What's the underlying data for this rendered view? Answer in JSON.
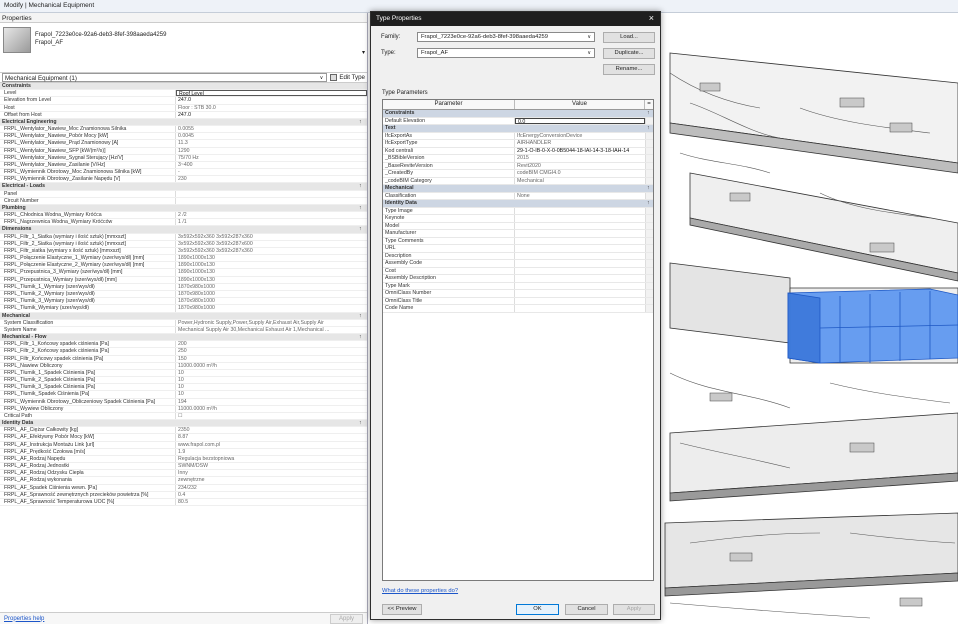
{
  "window": {
    "title": "Modify | Mechanical Equipment"
  },
  "properties": {
    "header": "Properties",
    "family_line1": "Frapol_7223e0ce-92a6-deb3-8fef-398aaeda4259",
    "family_line2": "Frapol_AF",
    "category_filter": "Mechanical Equipment (1)",
    "edit_type_label": "Edit Type",
    "help_link": "Properties help",
    "apply_label": "Apply",
    "rows": [
      {
        "t": "g",
        "k": "Constraints",
        "v": ""
      },
      {
        "t": "r",
        "k": "Level",
        "v": "Roof Level",
        "e": true
      },
      {
        "t": "r",
        "k": "Elevation from Level",
        "v": "247.0",
        "e": true,
        "nb": true
      },
      {
        "t": "r",
        "k": "Host",
        "v": "Floor : STB 30.0"
      },
      {
        "t": "r",
        "k": "Offset from Host",
        "v": "247.0",
        "e": true,
        "nb": true
      },
      {
        "t": "g",
        "k": "Electrical Engineering",
        "v": "↑"
      },
      {
        "t": "r",
        "k": "FRPL_Wentylator_Nawiew_Moc Znamionowa Silnika",
        "v": "0.0055"
      },
      {
        "t": "r",
        "k": "FRPL_Wentylator_Nawiew_Pobór Mocy [kW]",
        "v": "0.0045"
      },
      {
        "t": "r",
        "k": "FRPL_Wentylator_Nawiew_Prąd Znamionowy [A]",
        "v": "11.3"
      },
      {
        "t": "r",
        "k": "FRPL_Wentylator_Nawiew_SFP [kW/(m³/s)]",
        "v": "1290"
      },
      {
        "t": "r",
        "k": "FRPL_Wentylator_Nawiew_Sygnał Sterujący [Hz/V]",
        "v": "75/70 Hz"
      },
      {
        "t": "r",
        "k": "FRPL_Wentylator_Nawiew_Zasilanie [V/Hz]",
        "v": "3~400"
      },
      {
        "t": "r",
        "k": "FRPL_Wymiennik Obrotowy_Moc Znamionowa Silnika [kW]",
        "v": "-"
      },
      {
        "t": "r",
        "k": "FRPL_Wymiennik Obrotowy_Zasilanie Napędu [V]",
        "v": "230"
      },
      {
        "t": "g",
        "k": "Electrical - Loads",
        "v": "↑"
      },
      {
        "t": "r",
        "k": "Panel",
        "v": ""
      },
      {
        "t": "r",
        "k": "Circuit Number",
        "v": ""
      },
      {
        "t": "g",
        "k": "Plumbing",
        "v": "↑"
      },
      {
        "t": "r",
        "k": "FRPL_Chłodnica Wodna_Wymiary Króćca",
        "v": "2 /2"
      },
      {
        "t": "r",
        "k": "FRPL_Nagrzewnica Wodna_Wymiary Króćców",
        "v": "1 /1"
      },
      {
        "t": "g",
        "k": "Dimensions",
        "v": "↑"
      },
      {
        "t": "r",
        "k": "FRPL_Filtr_1_Siatka (wymiary i ilość sztuk) [mmxszt]",
        "v": "3x592x592x360 3x592x287x360"
      },
      {
        "t": "r",
        "k": "FRPL_Filtr_2_Siatka (wymiary i ilość sztuk) [mmxszt]",
        "v": "3x592x592x360 3x592x287x600"
      },
      {
        "t": "r",
        "k": "FRPL_Filtr_siatka (wymiary x ilość sztuk) [mmxszt]",
        "v": "3x592x592x360 3x592x287x360"
      },
      {
        "t": "r",
        "k": "FRPL_Połączenie Elastyczne_1_Wymiary (szer/wys/dł) [mm]",
        "v": "1890x1000x130"
      },
      {
        "t": "r",
        "k": "FRPL_Połączenie Elastyczne_2_Wymiary (szer/wys/dł) [mm]",
        "v": "1890x1000x130"
      },
      {
        "t": "r",
        "k": "FRPL_Przepustnica_3_Wymiary (szer/wys/dł) [mm]",
        "v": "1890x1000x130"
      },
      {
        "t": "r",
        "k": "FRPL_Przepustnica_Wymiary (szer/wys/dł) [mm]",
        "v": "1890x1000x130"
      },
      {
        "t": "r",
        "k": "FRPL_Tłumik_1_Wymiary (szer/wys/dł)",
        "v": "1870x980x1000"
      },
      {
        "t": "r",
        "k": "FRPL_Tłumik_2_Wymiary (szer/wys/dł)",
        "v": "1870x980x1000"
      },
      {
        "t": "r",
        "k": "FRPL_Tłumik_3_Wymiary (szer/wys/dł)",
        "v": "1870x980x1000"
      },
      {
        "t": "r",
        "k": "FRPL_Tłumik_Wymiary (szer/wys/dł)",
        "v": "1870x980x1000"
      },
      {
        "t": "g",
        "k": "Mechanical",
        "v": "↑"
      },
      {
        "t": "r",
        "k": "System Classification",
        "v": "Power,Hydronic Supply,Power,Supply Air,Exhaust Air,Supply Air"
      },
      {
        "t": "r",
        "k": "System Name",
        "v": "Mechanical Supply Air 30,Mechanical Exhaust Air 1,Mechanical ..."
      },
      {
        "t": "g",
        "k": "Mechanical - Flow",
        "v": "↑"
      },
      {
        "t": "r",
        "k": "FRPL_Filtr_1_Końcowy spadek ciśnienia [Pa]",
        "v": "200"
      },
      {
        "t": "r",
        "k": "FRPL_Filtr_2_Końcowy spadek ciśnienia [Pa]",
        "v": "250"
      },
      {
        "t": "r",
        "k": "FRPL_Filtr_Końcowy spadek ciśnienia [Pa]",
        "v": "150"
      },
      {
        "t": "r",
        "k": "FRPL_Nawiew Obliczony",
        "v": "11000.0000 m³/h"
      },
      {
        "t": "r",
        "k": "FRPL_Tłumik_1_Spadek Ciśnienia [Pa]",
        "v": "10"
      },
      {
        "t": "r",
        "k": "FRPL_Tłumik_2_Spadek Ciśnienia [Pa]",
        "v": "10"
      },
      {
        "t": "r",
        "k": "FRPL_Tłumik_3_Spadek Ciśnienia [Pa]",
        "v": "10"
      },
      {
        "t": "r",
        "k": "FRPL_Tłumik_Spadek Ciśnienia [Pa]",
        "v": "10"
      },
      {
        "t": "r",
        "k": "FRPL_Wymiennik Obrotowy_Obliczeniowy Spadek Ciśnienia [Pa]",
        "v": "194"
      },
      {
        "t": "r",
        "k": "FRPL_Wywiew Obliczony",
        "v": "11000.0000 m³/h"
      },
      {
        "t": "r",
        "k": "Critical Path",
        "v": "☐"
      },
      {
        "t": "g",
        "k": "Identity Data",
        "v": "↑"
      },
      {
        "t": "r",
        "k": "FRPL_AF_Ciężar Całkowity [kg]",
        "v": "2350"
      },
      {
        "t": "r",
        "k": "FRPL_AF_Efektywny Pobór Mocy [kW]",
        "v": "8.87"
      },
      {
        "t": "r",
        "k": "FRPL_AF_Instrukcja Montażu Link [url]",
        "v": "www.frapol.com.pl"
      },
      {
        "t": "r",
        "k": "FRPL_AF_Prędkość Czołowa [m/s]",
        "v": "1.9"
      },
      {
        "t": "r",
        "k": "FRPL_AF_Rodzaj Napędu",
        "v": "Regulacja bezstopniowa"
      },
      {
        "t": "r",
        "k": "FRPL_AF_Rodzaj Jednostki",
        "v": "SWNM/DSW"
      },
      {
        "t": "r",
        "k": "FRPL_AF_Rodzaj Odzysku Ciepła",
        "v": "Inny"
      },
      {
        "t": "r",
        "k": "FRPL_AF_Rodzaj wykonania",
        "v": "zewnętrzne"
      },
      {
        "t": "r",
        "k": "FRPL_AF_Spadek Ciśnienia wewn. [Pa]",
        "v": "234/232"
      },
      {
        "t": "r",
        "k": "FRPL_AF_Sprawność zewnętrznych przecieków powietrza [%]",
        "v": "0.4"
      },
      {
        "t": "r",
        "k": "FRPL_AF_Sprawność Temperaturowa UOC [%]",
        "v": "80.5"
      }
    ]
  },
  "dialog": {
    "title": "Type Properties",
    "family_label": "Family:",
    "family_value": "Frapol_7223e0ce-92a6-deb3-8fef-398aaeda4259",
    "type_label": "Type:",
    "type_value": "Frapol_AF",
    "load_btn": "Load...",
    "duplicate_btn": "Duplicate...",
    "rename_btn": "Rename...",
    "type_params_label": "Type Parameters",
    "col_param": "Parameter",
    "col_value": "Value",
    "col_marker": "=",
    "rows": [
      {
        "t": "g",
        "k": "Constraints",
        "v": "↑"
      },
      {
        "t": "r",
        "k": "Default Elevation",
        "v": "0.0",
        "e": true
      },
      {
        "t": "g",
        "k": "Text",
        "v": "↑"
      },
      {
        "t": "r",
        "k": "IfcExportAs",
        "v": "IfcEnergyConversionDevice"
      },
      {
        "t": "r",
        "k": "IfcExportType",
        "v": "AIRHANDLER"
      },
      {
        "t": "r",
        "k": "Kod centrali",
        "v": "29-1-O-IB-0-X-0-0B5044-18-IAI-14-3-18-IAH-14",
        "dark": true
      },
      {
        "t": "r",
        "k": "_BSBibleVersion",
        "v": "2015"
      },
      {
        "t": "r",
        "k": "_BaseReviteVersion",
        "v": "Revit2020"
      },
      {
        "t": "r",
        "k": "_CreatedBy",
        "v": "codeBIM  CMGI4.0"
      },
      {
        "t": "r",
        "k": "_codeBIM Category",
        "v": "Mechanical"
      },
      {
        "t": "g",
        "k": "Mechanical",
        "v": "↑"
      },
      {
        "t": "r",
        "k": "Classification",
        "v": "None"
      },
      {
        "t": "g",
        "k": "Identity Data",
        "v": "↑"
      },
      {
        "t": "r",
        "k": "Type Image",
        "v": ""
      },
      {
        "t": "r",
        "k": "Keynote",
        "v": "",
        "dark": true
      },
      {
        "t": "r",
        "k": "Model",
        "v": "",
        "dark": true
      },
      {
        "t": "r",
        "k": "Manufacturer",
        "v": "",
        "dark": true
      },
      {
        "t": "r",
        "k": "Type Comments",
        "v": "",
        "dark": true
      },
      {
        "t": "r",
        "k": "URL",
        "v": "",
        "dark": true
      },
      {
        "t": "r",
        "k": "Description",
        "v": "",
        "dark": true
      },
      {
        "t": "r",
        "k": "Assembly Code",
        "v": "",
        "dark": true
      },
      {
        "t": "r",
        "k": "Cost",
        "v": "",
        "dark": true
      },
      {
        "t": "r",
        "k": "Assembly Description",
        "v": ""
      },
      {
        "t": "r",
        "k": "Type Mark",
        "v": "",
        "dark": true
      },
      {
        "t": "r",
        "k": "OmniClass Number",
        "v": ""
      },
      {
        "t": "r",
        "k": "OmniClass Title",
        "v": ""
      },
      {
        "t": "r",
        "k": "Code Name",
        "v": ""
      }
    ],
    "help_link": "What do these properties do?",
    "preview_btn": "<< Preview",
    "ok_btn": "OK",
    "cancel_btn": "Cancel",
    "apply_btn": "Apply"
  },
  "colors": {
    "selection": "#3a7bdc",
    "dialog_title": "#1f1f1f",
    "group_bg": "#cdd6e3"
  }
}
